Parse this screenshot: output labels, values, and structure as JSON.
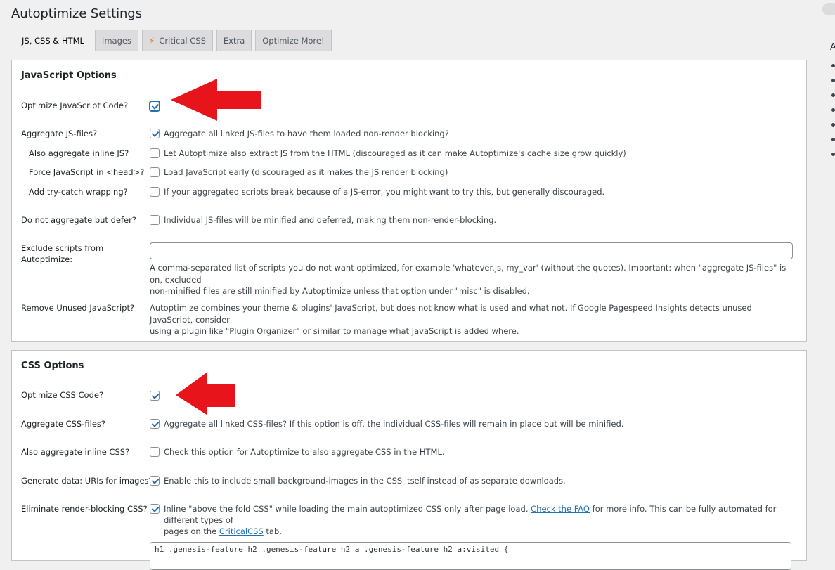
{
  "page": {
    "title": "Autoptimize Settings"
  },
  "tabs": [
    {
      "label": "JS, CSS & HTML",
      "active": true
    },
    {
      "label": "Images",
      "active": false
    },
    {
      "label": "Critical CSS",
      "active": false,
      "icon": "lightning-icon"
    },
    {
      "label": "Extra",
      "active": false
    },
    {
      "label": "Optimize More!",
      "active": false
    }
  ],
  "sidebar": {
    "heading_fragment": "A"
  },
  "js_section": {
    "title": "JavaScript Options",
    "optimize": {
      "label": "Optimize JavaScript Code?",
      "checked": true
    },
    "aggregate": {
      "label": "Aggregate JS-files?",
      "text": "Aggregate all linked JS-files to have them loaded non-render blocking?",
      "checked": true
    },
    "inline": {
      "label": "Also aggregate inline JS?",
      "text": "Let Autoptimize also extract JS from the HTML (discouraged as it can make Autoptimize's cache size grow quickly)",
      "checked": false
    },
    "force_head": {
      "label": "Force JavaScript in <head>?",
      "text": "Load JavaScript early (discouraged as it makes the JS render blocking)",
      "checked": false
    },
    "try_catch": {
      "label": "Add try-catch wrapping?",
      "text": "If your aggregated scripts break because of a JS-error, you might want to try this, but generally discouraged.",
      "checked": false
    },
    "defer": {
      "label": "Do not aggregate but defer?",
      "text": "Individual JS-files will be minified and deferred, making them non-render-blocking.",
      "checked": false
    },
    "exclude": {
      "label_line1": "Exclude scripts from",
      "label_line2": "Autoptimize:",
      "value": "",
      "help_line1": "A comma-separated list of scripts you do not want optimized, for example 'whatever.js, my_var' (without the quotes). Important: when \"aggregate JS-files\" is on, excluded",
      "help_line2": "non-minified files are still minified by Autoptimize unless that option under \"misc\" is disabled."
    },
    "unused": {
      "label": "Remove Unused JavaScript?",
      "text_line1": "Autoptimize combines your theme & plugins' JavaScript, but does not know what is used and what not. If Google Pagespeed Insights detects unused JavaScript, consider",
      "text_line2": "using a plugin like \"Plugin Organizer\" or similar to manage what JavaScript is added where."
    }
  },
  "css_section": {
    "title": "CSS Options",
    "optimize": {
      "label": "Optimize CSS Code?",
      "checked": true
    },
    "aggregate": {
      "label": "Aggregate CSS-files?",
      "text": "Aggregate all linked CSS-files? If this option is off, the individual CSS-files will remain in place but will be minified.",
      "checked": true
    },
    "inline": {
      "label": "Also aggregate inline CSS?",
      "text": "Check this option for Autoptimize to also aggregate CSS in the HTML.",
      "checked": false
    },
    "data_uris": {
      "label": "Generate data: URIs for images?",
      "text": "Enable this to include small background-images in the CSS itself instead of as separate downloads.",
      "checked": true
    },
    "render_blocking": {
      "label": "Eliminate render-blocking CSS?",
      "checked": true,
      "text_before_link": "Inline \"above the fold CSS\" while loading the main autoptimized CSS only after page load. ",
      "faq_link": "Check the FAQ",
      "text_after_link": " for more info. This can be fully automated for different types of",
      "line2_before": "pages on the ",
      "criticalcss_link": "CriticalCSS",
      "line2_after": " tab."
    },
    "critical_css_value": "h1 .genesis-feature h2 .genesis-feature h2 a .genesis-feature h2 a:visited {"
  },
  "annotations": {
    "arrow_color": "#e8141c"
  }
}
